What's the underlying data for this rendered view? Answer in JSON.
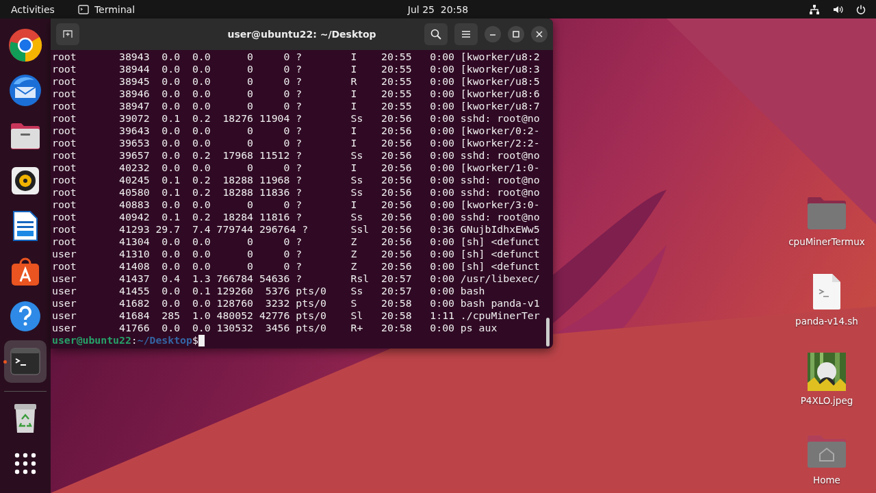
{
  "top_bar": {
    "activities": "Activities",
    "app_name": "Terminal",
    "clock": "Jul 25  20:58"
  },
  "dock": {
    "apps": [
      {
        "kind": "chrome",
        "active": false
      },
      {
        "kind": "mail",
        "active": false
      },
      {
        "kind": "files",
        "active": false
      },
      {
        "kind": "music",
        "active": false
      },
      {
        "kind": "writer",
        "active": false
      },
      {
        "kind": "software",
        "active": false
      },
      {
        "kind": "help",
        "active": false
      },
      {
        "kind": "terminal",
        "active": true
      },
      {
        "kind": "trash",
        "active": false
      }
    ]
  },
  "terminal": {
    "title": "user@ubuntu22: ~/Desktop",
    "lines": [
      "root       38943  0.0  0.0      0     0 ?        I    20:55   0:00 [kworker/u8:2",
      "root       38944  0.0  0.0      0     0 ?        I    20:55   0:00 [kworker/u8:3",
      "root       38945  0.0  0.0      0     0 ?        R    20:55   0:00 [kworker/u8:5",
      "root       38946  0.0  0.0      0     0 ?        I    20:55   0:00 [kworker/u8:6",
      "root       38947  0.0  0.0      0     0 ?        I    20:55   0:00 [kworker/u8:7",
      "root       39072  0.1  0.2  18276 11904 ?        Ss   20:56   0:00 sshd: root@no",
      "root       39643  0.0  0.0      0     0 ?        I    20:56   0:00 [kworker/0:2-",
      "root       39653  0.0  0.0      0     0 ?        I    20:56   0:00 [kworker/2:2-",
      "root       39657  0.0  0.2  17968 11512 ?        Ss   20:56   0:00 sshd: root@no",
      "root       40232  0.0  0.0      0     0 ?        I    20:56   0:00 [kworker/1:0-",
      "root       40245  0.1  0.2  18288 11968 ?        Ss   20:56   0:00 sshd: root@no",
      "root       40580  0.1  0.2  18288 11836 ?        Ss   20:56   0:00 sshd: root@no",
      "root       40883  0.0  0.0      0     0 ?        I    20:56   0:00 [kworker/3:0-",
      "root       40942  0.1  0.2  18284 11816 ?        Ss   20:56   0:00 sshd: root@no",
      "root       41293 29.7  7.4 779744 296764 ?       Ssl  20:56   0:36 GNujbIdhxEWw5",
      "root       41304  0.0  0.0      0     0 ?        Z    20:56   0:00 [sh] <defunct",
      "user       41310  0.0  0.0      0     0 ?        Z    20:56   0:00 [sh] <defunct",
      "root       41408  0.0  0.0      0     0 ?        Z    20:56   0:00 [sh] <defunct",
      "user       41437  0.4  1.3 766784 54636 ?        Rsl  20:57   0:00 /usr/libexec/",
      "user       41455  0.0  0.1 129260  5376 pts/0    Ss   20:57   0:00 bash",
      "user       41682  0.0  0.0 128760  3232 pts/0    S    20:58   0:00 bash panda-v1",
      "user       41684  285  1.0 480052 42776 pts/0    Sl   20:58   1:11 ./cpuMinerTer",
      "user       41766  0.0  0.0 130532  3456 pts/0    R+   20:58   0:00 ps aux"
    ],
    "prompt": {
      "user_host": "user@ubuntu22",
      "colon": ":",
      "path": "~/Desktop",
      "symbol": "$"
    }
  },
  "desktop_icons": [
    {
      "kind": "folder",
      "label": "cpuMinerTermux"
    },
    {
      "kind": "script",
      "label": "panda-v14.sh"
    },
    {
      "kind": "picture",
      "label": "P4XLO.jpeg"
    },
    {
      "kind": "home",
      "label": "Home"
    }
  ]
}
